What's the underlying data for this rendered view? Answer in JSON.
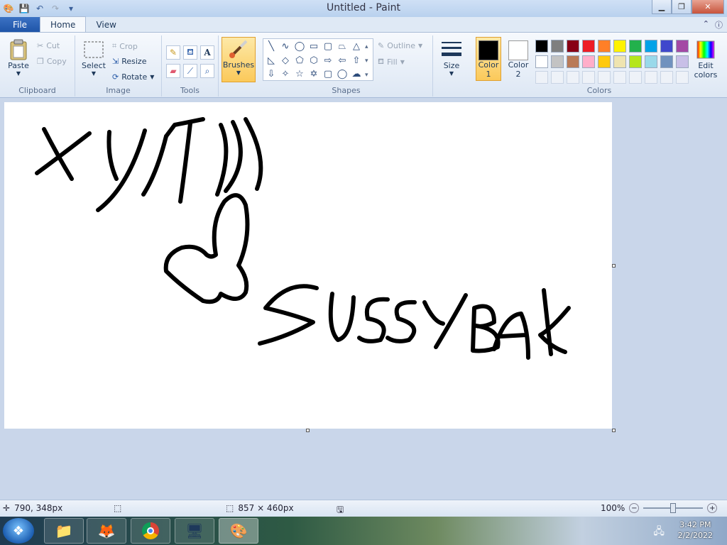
{
  "window": {
    "title": "Untitled - Paint"
  },
  "tabs": {
    "file": "File",
    "home": "Home",
    "view": "View"
  },
  "clipboard": {
    "paste": "Paste",
    "cut": "Cut",
    "copy": "Copy",
    "label": "Clipboard"
  },
  "image": {
    "select": "Select",
    "crop": "Crop",
    "resize": "Resize",
    "rotate": "Rotate",
    "label": "Image"
  },
  "tools": {
    "label": "Tools",
    "text_tool": "A"
  },
  "brushes": {
    "label": "Brushes"
  },
  "shapes": {
    "outline": "Outline",
    "fill": "Fill",
    "label": "Shapes"
  },
  "size": {
    "label": "Size"
  },
  "colors": {
    "color1_label": "Color",
    "color1_num": "1",
    "color2_label": "Color",
    "color2_num": "2",
    "edit_label1": "Edit",
    "edit_label2": "colors",
    "label": "Colors",
    "color1": "#000000",
    "color2": "#ffffff",
    "palette_row1": [
      "#000000",
      "#7f7f7f",
      "#880015",
      "#ed1c24",
      "#ff7f27",
      "#fff200",
      "#22b14c",
      "#00a2e8",
      "#3f48cc",
      "#a349a4"
    ],
    "palette_row2": [
      "#ffffff",
      "#c3c3c3",
      "#b97a57",
      "#ffaec9",
      "#ffc90e",
      "#efe4b0",
      "#b5e61d",
      "#99d9ea",
      "#7092be",
      "#c8bfe7"
    ]
  },
  "status": {
    "cursor_pos": "790, 348px",
    "canvas_size": "857 × 460px",
    "zoom": "100%"
  },
  "taskbar": {
    "time": "3:42 PM",
    "date": "2/2/2022"
  }
}
